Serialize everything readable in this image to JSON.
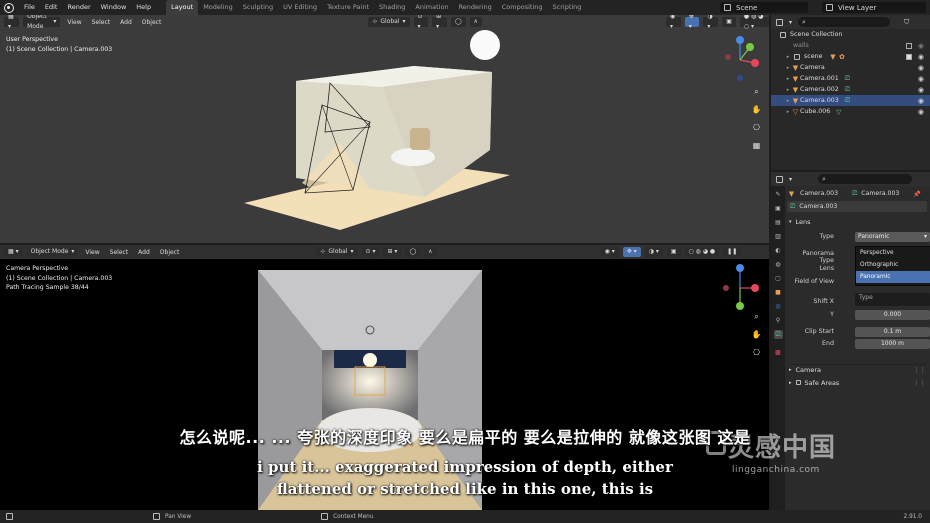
{
  "menu": {
    "items": [
      "File",
      "Edit",
      "Render",
      "Window",
      "Help"
    ]
  },
  "workspaces": {
    "tabs": [
      "Layout",
      "Modeling",
      "Sculpting",
      "UV Editing",
      "Texture Paint",
      "Shading",
      "Animation",
      "Rendering",
      "Compositing",
      "Scripting"
    ],
    "active": "Layout"
  },
  "scene": {
    "label": "Scene"
  },
  "view_layer": {
    "label": "View Layer"
  },
  "viewport_top": {
    "mode": "Object Mode",
    "menus": [
      "View",
      "Select",
      "Add",
      "Object"
    ],
    "transform": "Global",
    "info_line1": "User Perspective",
    "info_line2": "(1) Scene Collection | Camera.003"
  },
  "viewport_bottom": {
    "mode": "Object Mode",
    "menus": [
      "View",
      "Select",
      "Add",
      "Object"
    ],
    "transform": "Global",
    "info_line1": "Camera Perspective",
    "info_line2": "(1) Scene Collection | Camera.003",
    "info_line3": "Path Tracing Sample 38/44"
  },
  "outliner": {
    "root": "Scene Collection",
    "rows": [
      {
        "name": "walls",
        "kind": "collection"
      },
      {
        "name": "scene",
        "kind": "collection"
      },
      {
        "name": "Camera",
        "kind": "camera"
      },
      {
        "name": "Camera.001",
        "kind": "camera"
      },
      {
        "name": "Camera.002",
        "kind": "camera"
      },
      {
        "name": "Camera.003",
        "kind": "camera",
        "selected": true
      },
      {
        "name": "Cube.006",
        "kind": "mesh"
      }
    ]
  },
  "properties": {
    "object_name": "Camera.003",
    "data_name": "Camera.003",
    "datablock": "Camera.003",
    "section_lens": "Lens",
    "type_label": "Type",
    "type_value": "Panoramic",
    "panorama_type_label": "Panorama Type",
    "lens_label": "Lens",
    "fov_label": "Field of View",
    "shift_x_label": "Shift X",
    "y_label": "Y",
    "y_value": "0.000",
    "type_tooltip": "Type",
    "clip_start_label": "Clip Start",
    "clip_start_value": "0.1 m",
    "end_label": "End",
    "end_value": "1000 m",
    "section_camera": "Camera",
    "section_safe": "Safe Areas",
    "dropdown": [
      "Perspective",
      "Orthographic",
      "Panoramic"
    ]
  },
  "statusbar": {
    "pan_view": "Pan View",
    "context_menu": "Context Menu",
    "version": "2.91.0"
  },
  "subtitles": {
    "zh": "怎么说呢... ... 夸张的深度印象 要么是扁平的 要么是拉伸的 就像这张图 这是",
    "en1": "i put it... exaggerated impression of depth, either",
    "en2": "flattened or stretched like in this one, this is"
  },
  "watermark": {
    "zh": "灵感中国",
    "en": "lingganchina.com"
  },
  "colors": {
    "selection": "#334d80",
    "accent_blue": "#4a72b0",
    "camera_icon": "#e3a052",
    "data_icon": "#5fd6a0"
  }
}
